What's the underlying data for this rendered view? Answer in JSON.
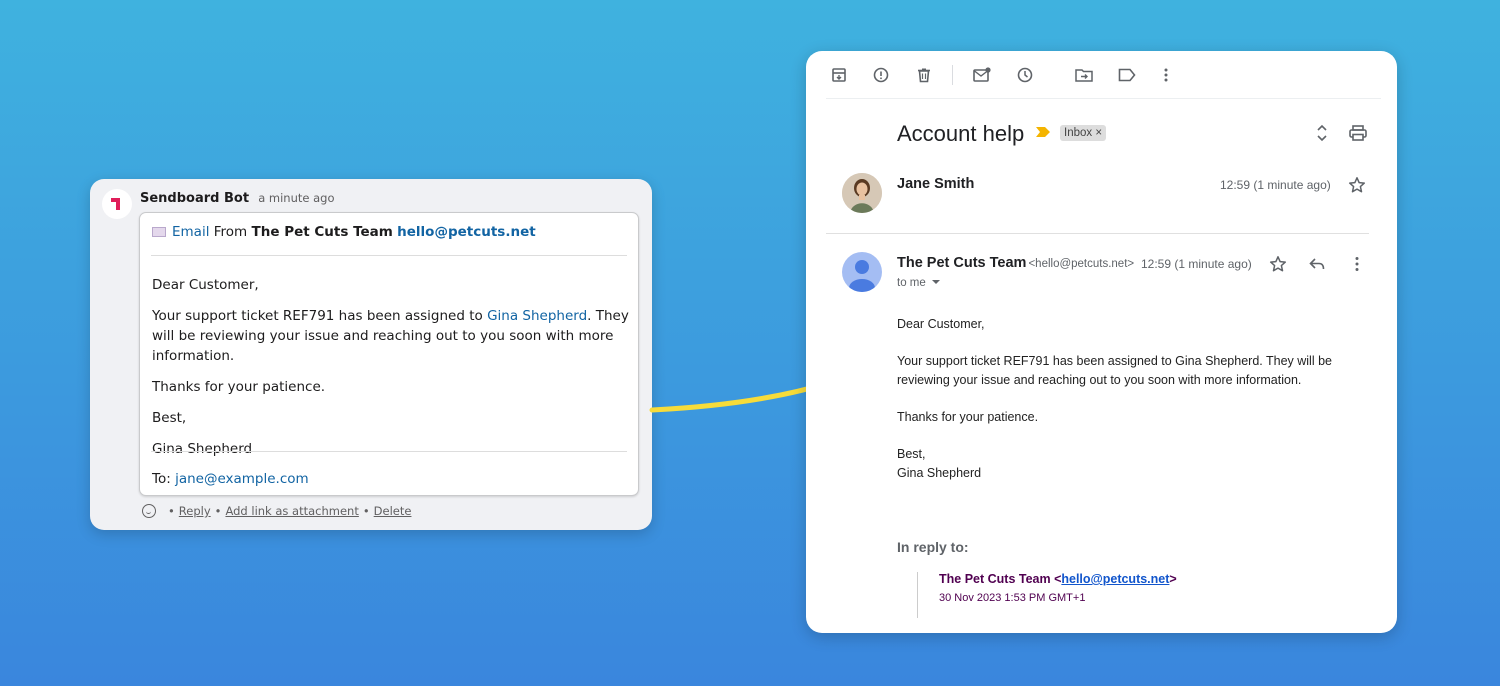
{
  "slack": {
    "bot_name": "Sendboard Bot",
    "bot_time": "a minute ago",
    "email_link": "Email",
    "from_word": "From",
    "from_name": "The Pet Cuts Team",
    "from_email": "hello@petcuts.net",
    "greeting": "Dear Customer,",
    "body_pre": "Your support ticket REF791 has been assigned to ",
    "body_assignee": "Gina Shepherd",
    "body_post": ". They will be reviewing your issue and reaching out to you soon with more information.",
    "thanks": "Thanks for your patience.",
    "signoff": "Best,",
    "signature": "Gina Shepherd",
    "to_label": "To:",
    "to_email": "jane@example.com",
    "actions": {
      "reply": "Reply",
      "add_link": "Add link as attachment",
      "delete": "Delete"
    },
    "brand_color": "#e01e5a"
  },
  "gmail": {
    "subject": "Account help",
    "chip": "Inbox",
    "chip_close": "×",
    "message1": {
      "sender": "Jane Smith",
      "time": "12:59 (1 minute ago)"
    },
    "message2": {
      "sender": "The Pet Cuts Team",
      "sender_email": "<hello@petcuts.net>",
      "time": "12:59 (1 minute ago)",
      "to": "to me",
      "greeting": "Dear Customer,",
      "body": "Your support ticket REF791 has been assigned to Gina Shepherd. They will be reviewing your issue and reaching out to you soon with more information.",
      "thanks": "Thanks for your patience.",
      "signoff": "Best,",
      "signature": "Gina Shepherd",
      "in_reply_label": "In reply to:",
      "quote_name": "The Pet Cuts Team <",
      "quote_email": "hello@petcuts.net",
      "quote_close": ">",
      "quote_date": "30 Nov 2023 1:53 PM GMT+1"
    },
    "toolbar_icons": [
      "archive-icon",
      "report-spam-icon",
      "delete-icon",
      "mark-unread-icon",
      "snooze-icon",
      "move-to-icon",
      "label-icon",
      "more-icon"
    ],
    "colors": {
      "important": "#f4b400",
      "quote": "#500050",
      "link": "#1155cc"
    }
  },
  "arrow_color": "#f7dc3a"
}
